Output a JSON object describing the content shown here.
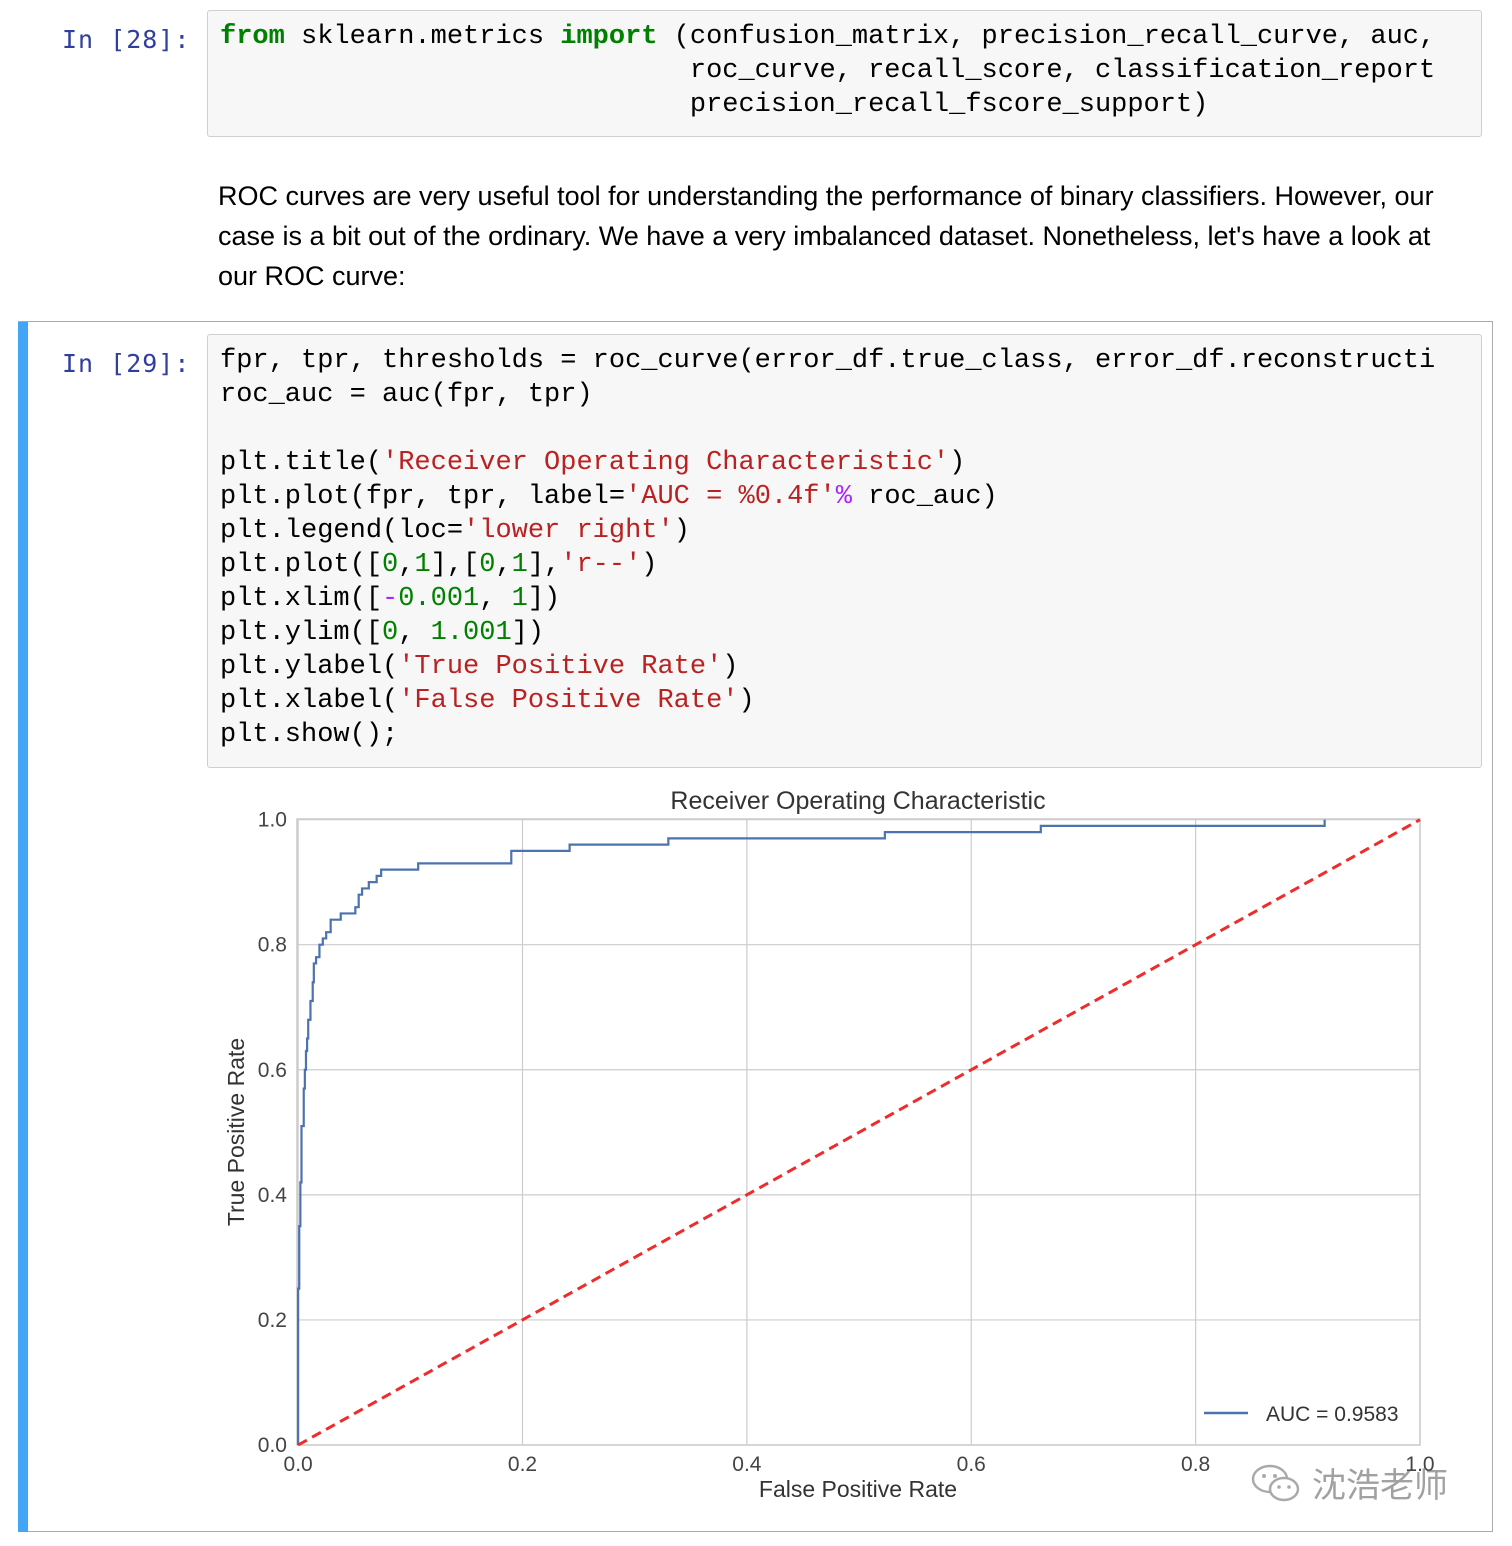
{
  "cell28": {
    "prompt": "In [28]:",
    "lines": [
      [
        {
          "t": "from",
          "c": "kw"
        },
        {
          "t": " sklearn.metrics ",
          "c": ""
        },
        {
          "t": "import",
          "c": "kw"
        },
        {
          "t": " (confusion_matrix, precision_recall_curve, auc,",
          "c": ""
        }
      ],
      [
        {
          "t": "                             roc_curve, recall_score, classification_report",
          "c": ""
        }
      ],
      [
        {
          "t": "                             precision_recall_fscore_support)",
          "c": ""
        }
      ]
    ]
  },
  "markdown": {
    "text": "ROC curves are very useful tool for understanding the performance of binary classifiers. However, our case is a bit out of the ordinary. We have a very imbalanced dataset. Nonetheless, let's have a look at our ROC curve:"
  },
  "cell29": {
    "prompt": "In [29]:",
    "lines": [
      [
        {
          "t": "fpr, tpr, thresholds = roc_curve(error_df.true_class, error_df.reconstructi",
          "c": ""
        }
      ],
      [
        {
          "t": "roc_auc = auc(fpr, tpr)",
          "c": ""
        }
      ],
      [
        {
          "t": "",
          "c": ""
        }
      ],
      [
        {
          "t": "plt.title(",
          "c": ""
        },
        {
          "t": "'Receiver Operating Characteristic'",
          "c": "str"
        },
        {
          "t": ")",
          "c": ""
        }
      ],
      [
        {
          "t": "plt.plot(fpr, tpr, label=",
          "c": ""
        },
        {
          "t": "'AUC = %0.4f'",
          "c": "str"
        },
        {
          "t": "%",
          "c": "op"
        },
        {
          "t": " roc_auc)",
          "c": ""
        }
      ],
      [
        {
          "t": "plt.legend(loc=",
          "c": ""
        },
        {
          "t": "'lower right'",
          "c": "str"
        },
        {
          "t": ")",
          "c": ""
        }
      ],
      [
        {
          "t": "plt.plot([",
          "c": ""
        },
        {
          "t": "0",
          "c": "num"
        },
        {
          "t": ",",
          "c": ""
        },
        {
          "t": "1",
          "c": "num"
        },
        {
          "t": "],[",
          "c": ""
        },
        {
          "t": "0",
          "c": "num"
        },
        {
          "t": ",",
          "c": ""
        },
        {
          "t": "1",
          "c": "num"
        },
        {
          "t": "],",
          "c": ""
        },
        {
          "t": "'r--'",
          "c": "str"
        },
        {
          "t": ")",
          "c": ""
        }
      ],
      [
        {
          "t": "plt.xlim([",
          "c": ""
        },
        {
          "t": "-",
          "c": "op"
        },
        {
          "t": "0.001",
          "c": "num"
        },
        {
          "t": ", ",
          "c": ""
        },
        {
          "t": "1",
          "c": "num"
        },
        {
          "t": "])",
          "c": ""
        }
      ],
      [
        {
          "t": "plt.ylim([",
          "c": ""
        },
        {
          "t": "0",
          "c": "num"
        },
        {
          "t": ", ",
          "c": ""
        },
        {
          "t": "1.001",
          "c": "num"
        },
        {
          "t": "])",
          "c": ""
        }
      ],
      [
        {
          "t": "plt.ylabel(",
          "c": ""
        },
        {
          "t": "'True Positive Rate'",
          "c": "str"
        },
        {
          "t": ")",
          "c": ""
        }
      ],
      [
        {
          "t": "plt.xlabel(",
          "c": ""
        },
        {
          "t": "'False Positive Rate'",
          "c": "str"
        },
        {
          "t": ")",
          "c": ""
        }
      ],
      [
        {
          "t": "plt.show();",
          "c": ""
        }
      ]
    ]
  },
  "chart_data": {
    "type": "line",
    "title": "Receiver Operating Characteristic",
    "xlabel": "False Positive Rate",
    "ylabel": "True Positive Rate",
    "xlim": [
      -0.001,
      1
    ],
    "ylim": [
      0,
      1.001
    ],
    "xticks": [
      "0.0",
      "0.2",
      "0.4",
      "0.6",
      "0.8",
      "1.0"
    ],
    "yticks": [
      "0.0",
      "0.2",
      "0.4",
      "0.6",
      "0.8",
      "1.0"
    ],
    "grid": true,
    "legend": {
      "loc": "lower right",
      "entries": [
        "AUC = 0.9583"
      ]
    },
    "series": [
      {
        "name": "AUC = 0.9583",
        "color": "#4c72b0",
        "style": "solid",
        "points": [
          [
            0.0,
            0.0
          ],
          [
            0.0,
            0.25
          ],
          [
            0.001,
            0.25
          ],
          [
            0.001,
            0.35
          ],
          [
            0.002,
            0.35
          ],
          [
            0.002,
            0.42
          ],
          [
            0.003,
            0.42
          ],
          [
            0.003,
            0.51
          ],
          [
            0.005,
            0.51
          ],
          [
            0.005,
            0.57
          ],
          [
            0.006,
            0.57
          ],
          [
            0.006,
            0.6
          ],
          [
            0.007,
            0.6
          ],
          [
            0.007,
            0.63
          ],
          [
            0.008,
            0.63
          ],
          [
            0.008,
            0.65
          ],
          [
            0.009,
            0.65
          ],
          [
            0.009,
            0.68
          ],
          [
            0.011,
            0.68
          ],
          [
            0.011,
            0.71
          ],
          [
            0.013,
            0.71
          ],
          [
            0.013,
            0.74
          ],
          [
            0.014,
            0.74
          ],
          [
            0.014,
            0.77
          ],
          [
            0.016,
            0.77
          ],
          [
            0.016,
            0.78
          ],
          [
            0.019,
            0.78
          ],
          [
            0.019,
            0.8
          ],
          [
            0.022,
            0.8
          ],
          [
            0.022,
            0.81
          ],
          [
            0.025,
            0.81
          ],
          [
            0.025,
            0.82
          ],
          [
            0.029,
            0.82
          ],
          [
            0.029,
            0.84
          ],
          [
            0.038,
            0.84
          ],
          [
            0.038,
            0.85
          ],
          [
            0.051,
            0.85
          ],
          [
            0.051,
            0.86
          ],
          [
            0.054,
            0.86
          ],
          [
            0.054,
            0.88
          ],
          [
            0.057,
            0.88
          ],
          [
            0.057,
            0.89
          ],
          [
            0.063,
            0.89
          ],
          [
            0.063,
            0.9
          ],
          [
            0.07,
            0.9
          ],
          [
            0.07,
            0.91
          ],
          [
            0.074,
            0.91
          ],
          [
            0.074,
            0.92
          ],
          [
            0.107,
            0.92
          ],
          [
            0.107,
            0.93
          ],
          [
            0.19,
            0.93
          ],
          [
            0.19,
            0.95
          ],
          [
            0.242,
            0.95
          ],
          [
            0.242,
            0.96
          ],
          [
            0.33,
            0.96
          ],
          [
            0.33,
            0.97
          ],
          [
            0.523,
            0.97
          ],
          [
            0.523,
            0.98
          ],
          [
            0.662,
            0.98
          ],
          [
            0.662,
            0.99
          ],
          [
            0.915,
            0.99
          ],
          [
            0.915,
            1.0
          ]
        ]
      },
      {
        "name": "",
        "color": "#ee2c2c",
        "style": "dashed",
        "points": [
          [
            0,
            0
          ],
          [
            1,
            1
          ]
        ]
      }
    ]
  },
  "watermark": {
    "text": "沈浩老师",
    "icon": "wechat-icon"
  }
}
